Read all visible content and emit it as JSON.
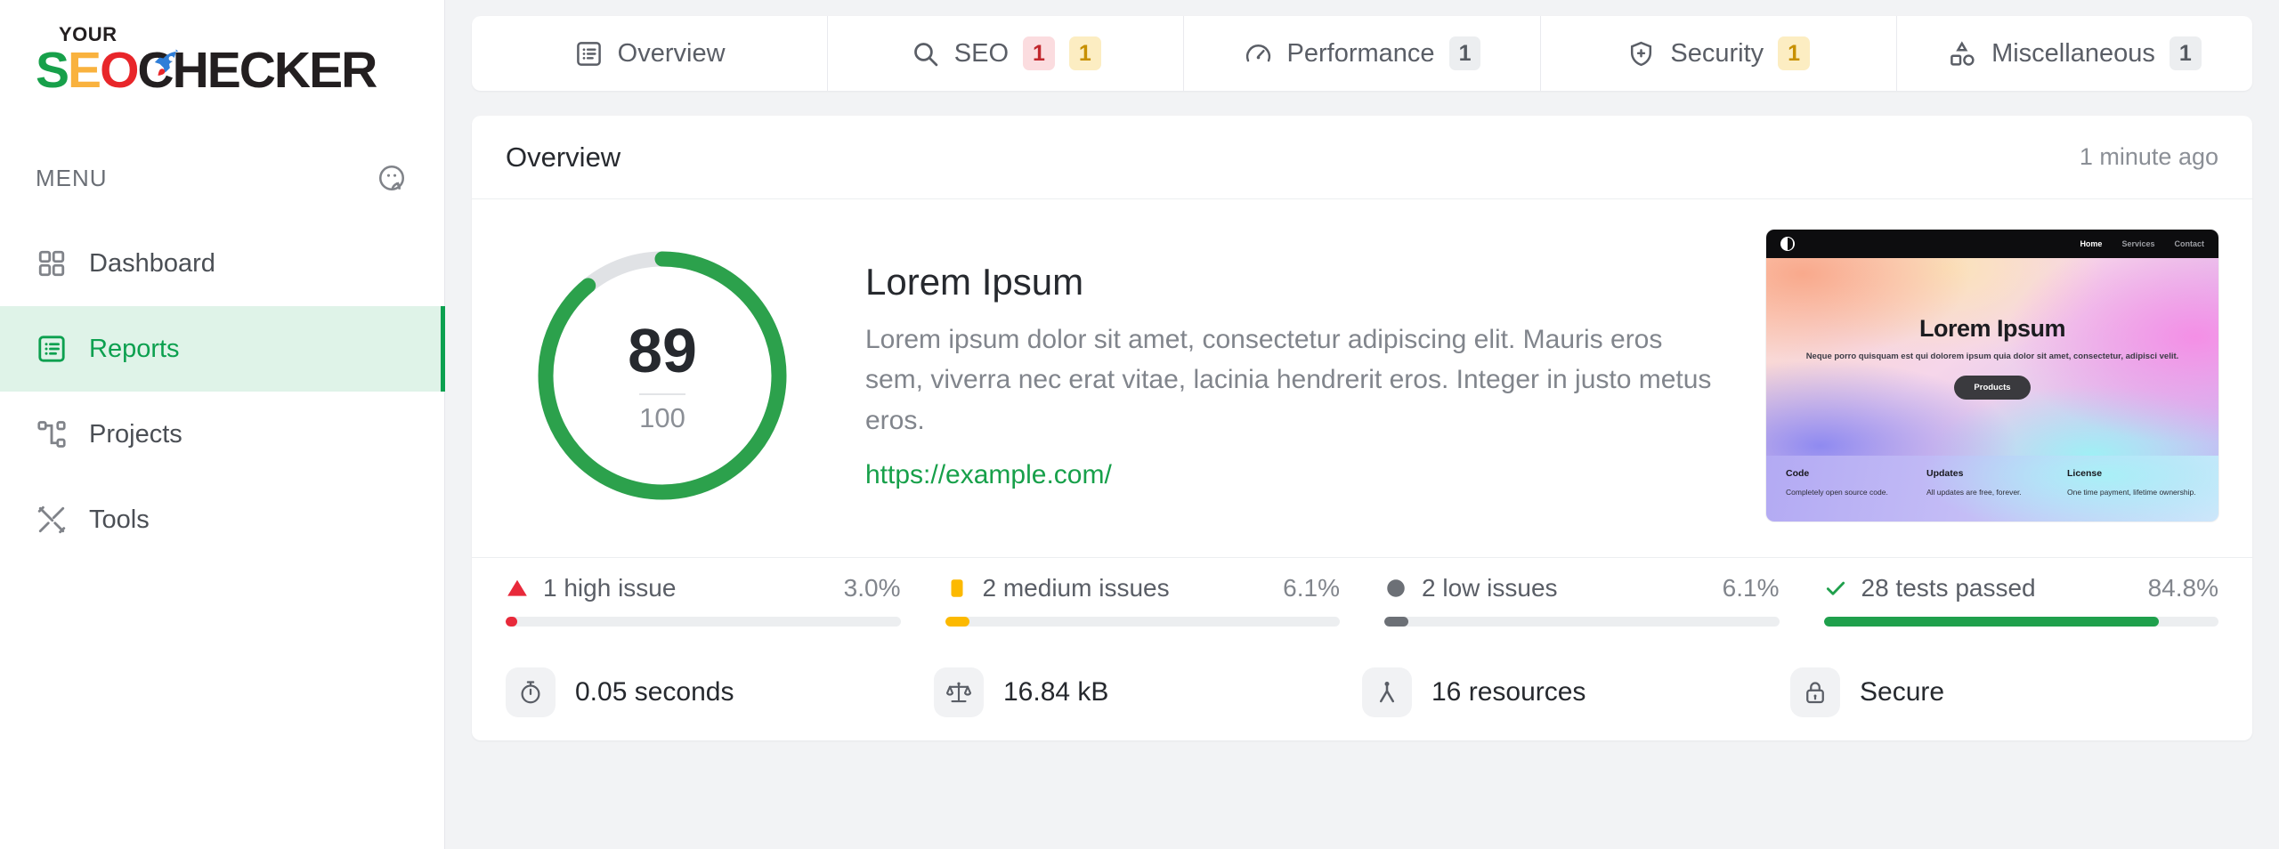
{
  "brand": {
    "top": "YOUR",
    "s": "S",
    "e": "E",
    "o": "O",
    "rest": "CHECKER",
    "rocket_icon": "rocket-icon"
  },
  "sidebar": {
    "menu_label": "MENU",
    "menu_head_icon": "user-profile-icon",
    "items": [
      {
        "label": "Dashboard",
        "icon": "grid-icon",
        "active": false
      },
      {
        "label": "Reports",
        "icon": "list-box-icon",
        "active": true
      },
      {
        "label": "Projects",
        "icon": "sitemap-icon",
        "active": false
      },
      {
        "label": "Tools",
        "icon": "tools-icon",
        "active": false
      }
    ]
  },
  "tabs": [
    {
      "label": "Overview",
      "icon": "list-box-icon",
      "badges": []
    },
    {
      "label": "SEO",
      "icon": "search-icon",
      "badges": [
        {
          "value": "1",
          "color": "red"
        },
        {
          "value": "1",
          "color": "yellow"
        }
      ]
    },
    {
      "label": "Performance",
      "icon": "gauge-icon",
      "badges": [
        {
          "value": "1",
          "color": "gray"
        }
      ]
    },
    {
      "label": "Security",
      "icon": "shield-icon",
      "badges": [
        {
          "value": "1",
          "color": "yellow"
        }
      ]
    },
    {
      "label": "Miscellaneous",
      "icon": "shapes-icon",
      "badges": [
        {
          "value": "1",
          "color": "gray"
        }
      ]
    }
  ],
  "card": {
    "title": "Overview",
    "timestamp": "1 minute ago"
  },
  "score": {
    "value": "89",
    "max": "100",
    "percent": 89,
    "arc_color": "#2ca14c",
    "track_color": "#e0e2e5"
  },
  "site": {
    "title": "Lorem Ipsum",
    "description": "Lorem ipsum dolor sit amet, consectetur adipiscing elit. Mauris eros sem, viverra nec erat vitae, lacinia hendrerit eros. Integer in justo metus eros.",
    "url": "https://example.com/"
  },
  "preview": {
    "logo_icon": "circle-logo-icon",
    "nav": [
      "Home",
      "Services",
      "Contact"
    ],
    "heading": "Lorem Ipsum",
    "subheading": "Neque porro quisquam est qui dolorem ipsum quia dolor sit amet, consectetur, adipisci velit.",
    "cta": "Products",
    "footer": [
      {
        "title": "Code",
        "text": "Completely open source code."
      },
      {
        "title": "Updates",
        "text": "All updates are free, forever."
      },
      {
        "title": "License",
        "text": "One time payment, lifetime ownership."
      }
    ]
  },
  "issues": [
    {
      "icon": "triangle-warning-icon",
      "label": "1 high issue",
      "percent": "3.0%",
      "value": 3.0,
      "color": "#e8293a"
    },
    {
      "icon": "square-icon",
      "label": "2 medium issues",
      "percent": "6.1%",
      "value": 6.1,
      "color": "#fcb900"
    },
    {
      "icon": "circle-icon",
      "label": "2 low issues",
      "percent": "6.1%",
      "value": 6.1,
      "color": "#6c7076"
    },
    {
      "icon": "check-icon",
      "label": "28 tests passed",
      "percent": "84.8%",
      "value": 84.8,
      "color": "#1fa04c"
    }
  ],
  "metrics": [
    {
      "icon": "stopwatch-icon",
      "value": "0.05 seconds"
    },
    {
      "icon": "scale-icon",
      "value": "16.84 kB"
    },
    {
      "icon": "resources-icon",
      "value": "16 resources"
    },
    {
      "icon": "lock-icon",
      "value": "Secure"
    }
  ]
}
